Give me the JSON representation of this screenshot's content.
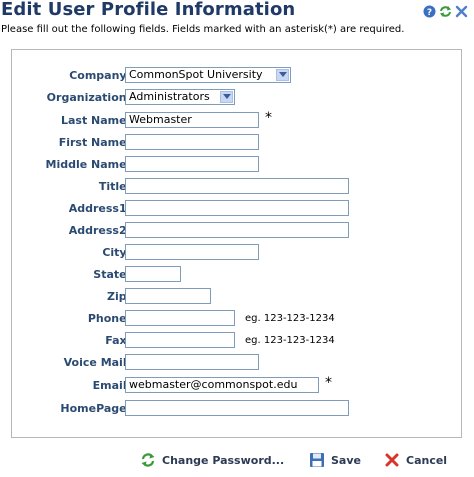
{
  "header": {
    "title": "Edit User Profile Information",
    "icons": [
      "help-icon",
      "refresh-icon",
      "close-icon"
    ]
  },
  "instructions": "Please fill out the following fields. Fields marked with an asterisk(*) are required.",
  "form": {
    "company": {
      "label": "Company:",
      "value": "CommonSpot University"
    },
    "organization": {
      "label": "Organization:",
      "value": "Administrators"
    },
    "last_name": {
      "label": "Last Name:",
      "value": "Webmaster",
      "required": "*"
    },
    "first_name": {
      "label": "First Name:",
      "value": ""
    },
    "middle_name": {
      "label": "Middle Name:",
      "value": ""
    },
    "title": {
      "label": "Title:",
      "value": ""
    },
    "address1": {
      "label": "Address1:",
      "value": ""
    },
    "address2": {
      "label": "Address2:",
      "value": ""
    },
    "city": {
      "label": "City:",
      "value": ""
    },
    "state": {
      "label": "State:",
      "value": ""
    },
    "zip": {
      "label": "Zip:",
      "value": ""
    },
    "phone": {
      "label": "Phone:",
      "value": "",
      "hint": "eg. 123-123-1234"
    },
    "fax": {
      "label": "Fax:",
      "value": "",
      "hint": "eg. 123-123-1234"
    },
    "voice_mail": {
      "label": "Voice Mail:",
      "value": ""
    },
    "email": {
      "label": "Email:",
      "value": "webmaster@commonspot.edu",
      "required": "*"
    },
    "homepage": {
      "label": "HomePage:",
      "value": ""
    }
  },
  "footer": {
    "change_password": "Change Password...",
    "save": "Save",
    "cancel": "Cancel"
  },
  "colors": {
    "title": "#1f3a67",
    "label": "#2b4a72",
    "field_border": "#7f9db9",
    "cancel_icon": "#d9332b",
    "refresh_icon": "#3a9a3a"
  }
}
